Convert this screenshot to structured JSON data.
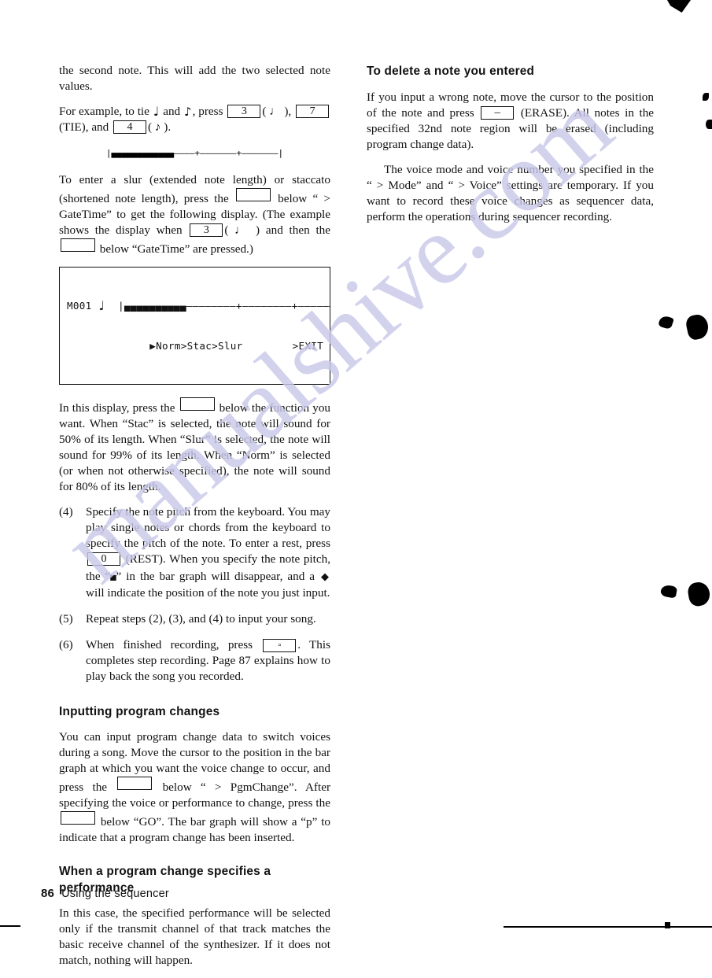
{
  "page": {
    "number": "86",
    "footer_title": "Using the sequencer",
    "watermark": "manualshive.com",
    "watermark_color": "#c9c9ea"
  },
  "left_column": {
    "para_continued_1": "the second note. This will add the two selected note values.",
    "example_tie": {
      "lead": "For example, to tie",
      "note_quarter": "♩",
      "and": "and",
      "note_eighth": "♪",
      "press": ", press",
      "key_3": "3",
      "paren_quarter": "( ♩ ),",
      "key_7": "7",
      "tie_label": "(TIE), and",
      "key_4": "4",
      "paren_eighth": "( ♪ )."
    },
    "bargraph_example": {
      "left_bar": "|",
      "filled": "▄▄▄▄▄▄▄▄▄▄▄▄",
      "dashes_1": "————",
      "plus_1": "+",
      "dashes_2": "———————",
      "plus_2": "+",
      "dashes_3": "———————",
      "right_bar": "|"
    },
    "para_slur": {
      "t1": "To enter a slur (extended note length) or staccato (shortened note length), press the",
      "key_blank_1": "",
      "t2": "below “ > GateTime” to get the following display. (The example shows the display when",
      "key_3": "3",
      "t3": "( ♩ ) and then the",
      "key_blank_2": "",
      "t4": "below “GateTime” are pressed.)"
    },
    "lcd": {
      "line1_label": "M001",
      "line1_note": "♩",
      "line1_bar_left": "|",
      "line1_filled": "▄▄▄▄▄▄▄▄▄▄",
      "line1_dashes1": "————————",
      "line1_plus1": "+",
      "line1_dashes2": "————————",
      "line1_plus2": "+",
      "line1_dashes3": "———————",
      "line1_bar_right": "|",
      "line2_menu": "▶Norm>Stac>Slur",
      "line2_exit": ">EXIT"
    },
    "para_display": {
      "t1": "In this display, press the",
      "key_blank": "",
      "t2": "below the function you want. When “Stac” is selected, the note will sound for 50% of its length. When “Slur” is selected, the note will sound for 99% of its length. When “Norm” is selected (or when not otherwise specified), the note will sound for 80% of its length."
    },
    "step_4": {
      "num": "(4)",
      "t1": "Specify the note pitch from the keyboard. You may play single notes or chords from the keyboard to specify the pitch of the note. To enter a rest, press",
      "key_0": "0",
      "t2": "(REST). When you specify the note pitch, the “",
      "dash_glyph": "▄",
      "t3": "” in the bar graph will disappear, and a",
      "diamond_glyph": "◆",
      "t4": "will indicate the position of the note you just input."
    },
    "step_5": {
      "num": "(5)",
      "text": "Repeat steps (2), (3), and  (4) to input your song."
    },
    "step_6": {
      "num": "(6)",
      "t1": "When finished recording, press",
      "key_stop": "▫",
      "t2": ". This completes step recording. Page 87 explains how to play back the song you recorded."
    },
    "heading_program_changes": "Inputting program changes",
    "para_program_changes": {
      "t1": "You can input program change data to switch voices during a song.  Move the cursor to the position in the bar graph at which you want the voice change to occur, and press the",
      "key_blank_1": "",
      "t2": "below “ > PgmChange”. After specifying the voice or performance to change, press the",
      "key_blank_2": "",
      "t3": "below “GO”. The bar graph will show a “p” to indicate that a program change has been inserted."
    },
    "heading_performance": "When a program change specifies a performance",
    "para_performance": "In this case, the specified performance will be selected only if the transmit channel of that track matches the basic receive channel of the synthesizer.  If it does not match, nothing will happen."
  },
  "right_column": {
    "heading_delete": "To delete a note you entered",
    "para_delete": {
      "t1": "If you input a wrong note, move the cursor to the position of the note and press",
      "key_minus": "–",
      "t2": "(ERASE). All notes in the specified 32nd note region will be erased (including program change data)."
    },
    "para_voice_mode": "The voice mode and voice number you specified in the “ > Mode” and “ > Voice” settings are temporary. If you want to record these voice changes as sequencer data, perform the operations during sequencer recording."
  }
}
